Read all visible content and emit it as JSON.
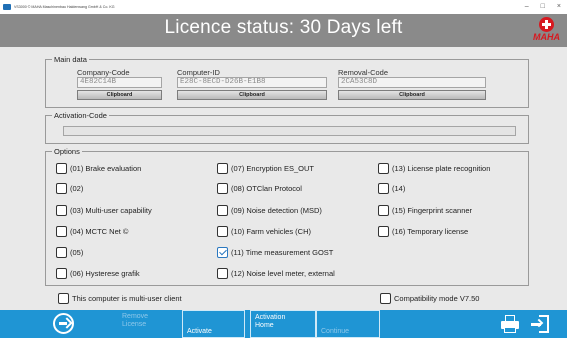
{
  "window": {
    "title": "VS3000 © MAHA Maschinenbau Haldenwang GmbH & Co. KG",
    "minimize_glyph": "–",
    "maximize_glyph": "□",
    "close_glyph": "×"
  },
  "header": {
    "title": "Licence status: 30 Days left",
    "logo_text": "MAHA",
    "logo_color": "#d71920"
  },
  "main_data": {
    "legend": "Main data",
    "company": {
      "label": "Company-Code",
      "value": "4E82C14B",
      "button": "Clipboard"
    },
    "computer": {
      "label": "Computer-ID",
      "value": "E28C-8ECD-D26B-E1B8",
      "button": "Clipboard"
    },
    "removal": {
      "label": "Removal-Code",
      "value": "2CA53C8D",
      "button": "Clipboard"
    }
  },
  "activation": {
    "legend": "Activation-Code",
    "value": ""
  },
  "options": {
    "legend": "Options",
    "items": [
      {
        "label": "(01) Brake evaluation",
        "checked": false
      },
      {
        "label": "(02)",
        "checked": false
      },
      {
        "label": "(03) Multi-user capability",
        "checked": false
      },
      {
        "label": "(04) MCTC Net ©",
        "checked": false
      },
      {
        "label": "(05)",
        "checked": false
      },
      {
        "label": "(06) Hysterese grafik",
        "checked": false
      },
      {
        "label": "(07) Encryption ES_OUT",
        "checked": false
      },
      {
        "label": "(08) OTClan Protocol",
        "checked": false
      },
      {
        "label": "(09) Noise detection (MSD)",
        "checked": false
      },
      {
        "label": "(10) Farm vehicles (CH)",
        "checked": false
      },
      {
        "label": "(11) Time measurement GOST",
        "checked": true
      },
      {
        "label": "(12) Noise level meter, external",
        "checked": false
      },
      {
        "label": "(13) License plate recognition",
        "checked": false
      },
      {
        "label": "(14)",
        "checked": false
      },
      {
        "label": "(15) Fingerprint scanner",
        "checked": false
      },
      {
        "label": "(16) Temporary license",
        "checked": false
      }
    ]
  },
  "footer_options": {
    "multiuser_client": {
      "label": "This computer is multi-user client",
      "checked": false
    },
    "compatibility": {
      "label": "Compatibility mode V7.50",
      "checked": false
    }
  },
  "bottom_bar": {
    "color": "#1f95d4",
    "next_icon": "arrow-right-circle-icon",
    "remove_license": {
      "line1": "Remove",
      "line2": "License",
      "enabled": false
    },
    "activate": {
      "label": "Activate",
      "enabled": true
    },
    "activation_home": {
      "line1": "Activation",
      "line2": "Home",
      "enabled": true
    },
    "continue": {
      "label": "Continue",
      "enabled": false
    },
    "print_icon": "printer-icon",
    "exit_icon": "exit-door-icon"
  }
}
